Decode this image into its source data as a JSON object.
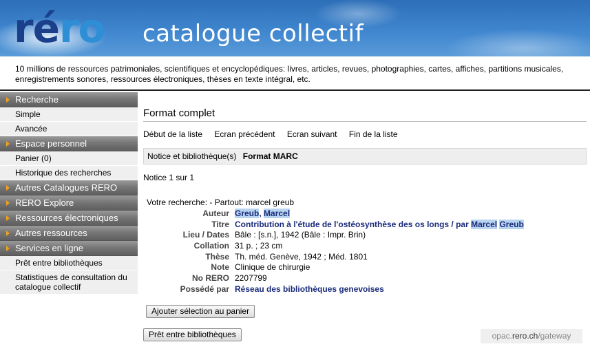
{
  "banner": {
    "logo_part1": "ré",
    "logo_part2": "ro",
    "title": "catalogue collectif"
  },
  "intro": "10 millions de ressources patrimoniales, scientifiques et encyclopédiques: livres, articles, revues, photographies, cartes, affiches, partitions musicales, enregistrements sonores, ressources électroniques, thèses en texte intégral, etc.",
  "sidebar": {
    "recherche": "Recherche",
    "simple": "Simple",
    "avancee": "Avancée",
    "espace": "Espace personnel",
    "panier": "Panier (0)",
    "historique": "Historique des recherches",
    "autres_catalogues": "Autres Catalogues RERO",
    "explore": "RERO Explore",
    "ressources_elec": "Ressources électroniques",
    "autres_ressources": "Autres ressources",
    "services": "Services en ligne",
    "pret": "Prêt entre bibliothèques",
    "stats": "Statistiques de consultation du catalogue collectif"
  },
  "main": {
    "title": "Format complet",
    "nav": {
      "first": "Début de la liste",
      "prev": "Ecran précédent",
      "next": "Ecran suivant",
      "last": "Fin de la liste"
    },
    "tabs": {
      "notice": "Notice et bibliothèque(s)",
      "marc": "Format MARC"
    },
    "counter": "Notice 1 sur 1",
    "query": "Votre recherche: - Partout: marcel greub",
    "record": {
      "auteur_label": "Auteur",
      "auteur_last": "Greub",
      "auteur_sep": ",",
      "auteur_first": "Marcel",
      "titre_label": "Titre",
      "titre_text": "Contribution à l'étude de l'ostéosynthèse des os longs / par ",
      "titre_hl1": "Marcel",
      "titre_hl2": "Greub",
      "lieu_label": "Lieu / Dates",
      "lieu_value": "Bâle : [s.n.], 1942 (Bâle : Impr. Brin)",
      "collation_label": "Collation",
      "collation_value": "31 p. ; 23 cm",
      "these_label": "Thèse",
      "these_value": "Th. méd. Genève, 1942 ; Méd. 1801",
      "note_label": "Note",
      "note_value": "Clinique de chirurgie",
      "norero_label": "No RERO",
      "norero_value": "2207799",
      "possede_label": "Possédé par",
      "possede_value": "Réseau des bibliothèques genevoises"
    },
    "add_button": "Ajouter sélection au panier",
    "ill_button": "Prêt entre bibliothèques"
  },
  "footer": {
    "opac": "opac.",
    "rero": "rero.ch",
    "gateway": "/gateway"
  }
}
